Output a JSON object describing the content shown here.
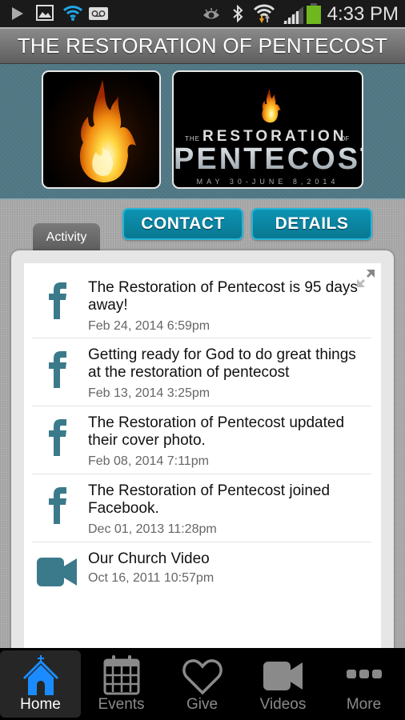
{
  "status_bar": {
    "time": "4:33 PM",
    "left_icons": [
      "play-icon",
      "image-icon",
      "wifi-icon",
      "voicemail-icon"
    ],
    "right_icons": [
      "eye-icon",
      "bluetooth-icon",
      "wifi-transfer-icon",
      "signal-icon",
      "battery-icon"
    ],
    "wifi_color": "#1ea6e6",
    "battery_color": "#6fb71f"
  },
  "header": {
    "title": "THE RESTORATION OF PENTECOST"
  },
  "banner": {
    "promo": {
      "the": "THE",
      "restoration": "RESTORATION",
      "of": "OF",
      "pentecost": "PENTECOST",
      "dates": "MAY 30-JUNE 8,2014"
    }
  },
  "actions": {
    "contact_label": "CONTACT",
    "details_label": "DETAILS",
    "accent": "#0d93b3"
  },
  "tabs": {
    "activity_label": "Activity"
  },
  "feed": {
    "items": [
      {
        "icon": "facebook-icon",
        "text": "The Restoration of Pentecost is 95 days away!",
        "date": "Feb 24, 2014 6:59pm"
      },
      {
        "icon": "facebook-icon",
        "text": "Getting ready for God to do great things at the restoration of pentecost",
        "date": "Feb 13, 2014 3:25pm"
      },
      {
        "icon": "facebook-icon",
        "text": "The Restoration of Pentecost updated their cover photo.",
        "date": "Feb 08, 2014 7:11pm"
      },
      {
        "icon": "facebook-icon",
        "text": "The Restoration of Pentecost joined Facebook.",
        "date": "Dec 01, 2013 11:28pm"
      },
      {
        "icon": "video-camera-icon",
        "text": "Our Church Video",
        "date": "Oct 16, 2011 10:57pm"
      }
    ],
    "icon_color": "#3b7a8a"
  },
  "bottom_nav": {
    "items": [
      {
        "label": "Home",
        "active": true
      },
      {
        "label": "Events",
        "active": false
      },
      {
        "label": "Give",
        "active": false
      },
      {
        "label": "Videos",
        "active": false
      },
      {
        "label": "More",
        "active": false
      }
    ],
    "active_color": "#1a8cff",
    "inactive_color": "#8a8a8a"
  }
}
